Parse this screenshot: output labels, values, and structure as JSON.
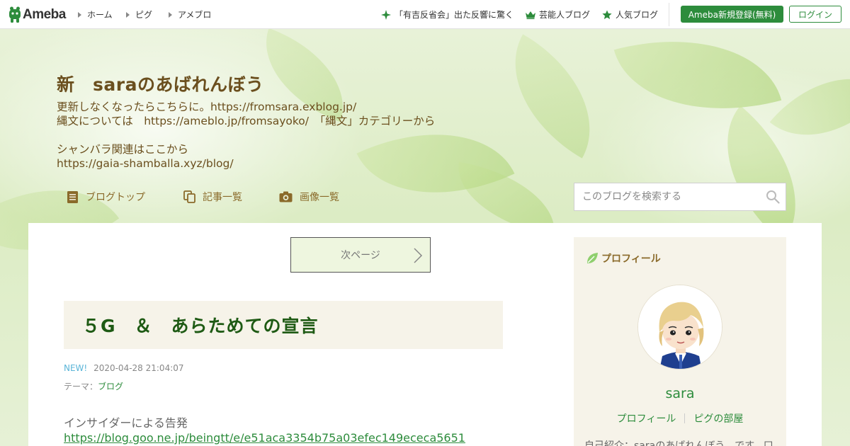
{
  "header": {
    "logo_text": "Ameba",
    "nav": [
      "ホーム",
      "ピグ",
      "アメブロ"
    ],
    "trending": "「有吉反省会」出た反響に驚く",
    "celebrity_blogs": "芸能人ブログ",
    "popular_blogs": "人気ブログ",
    "register_label": "Ameba新規登録(無料)",
    "login_label": "ログイン"
  },
  "blog": {
    "title": "新　saraのあばれんぼう",
    "description": [
      "更新しなくなったらこちらに。https://fromsara.exblog.jp/",
      "縄文については　https://ameblo.jp/fromsayoko/　「縄文」カテゴリーから",
      "シャンバラ関連はここから",
      "https://gaia-shamballa.xyz/blog/"
    ],
    "nav": {
      "top": "ブログトップ",
      "entries": "記事一覧",
      "images": "画像一覧"
    },
    "search_placeholder": "このブログを検索する"
  },
  "pager": {
    "next_label": "次ページ"
  },
  "entry": {
    "title": "５G　＆　あらためての宣言",
    "new_badge": "NEW!",
    "date": "2020-04-28 21:04:07",
    "theme_label": "テーマ：",
    "theme_value": "ブログ",
    "body_line": "インサイダーによる告発",
    "body_link": "https://blog.goo.ne.jp/beingtt/e/e51aca3354b75a03efec149ececa5651"
  },
  "profile": {
    "heading": "プロフィール",
    "name": "sara",
    "link_profile": "プロフィール",
    "link_pig_room": "ピグの部屋",
    "intro": "自己紹介：saraのあばれんぼう　です。口"
  },
  "colors": {
    "brand_green": "#2d8c3c",
    "title_brown": "#6b4f1e",
    "entry_title_green": "#1e5a14",
    "new_badge_blue": "#5bb5d8"
  },
  "icons": [
    "ameba-logo-icon",
    "chevron-right-icon",
    "sparkle-icon",
    "crown-icon",
    "star-icon",
    "document-icon",
    "copy-icon",
    "camera-icon",
    "search-icon",
    "arrow-right-icon",
    "leaf-icon"
  ]
}
